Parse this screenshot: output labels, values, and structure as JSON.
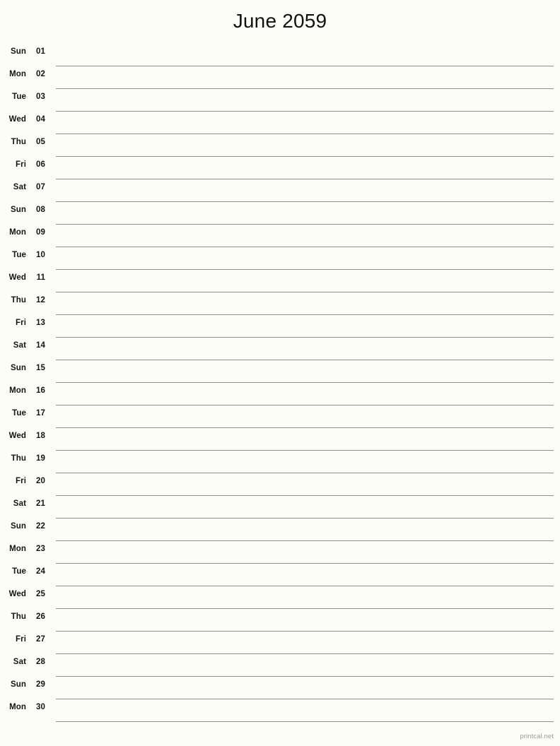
{
  "header": {
    "title": "June 2059"
  },
  "footer": {
    "credit": "printcal.net"
  },
  "colors": {
    "page_background": "#fdfdf8",
    "rule_line": "#8a8c86",
    "text": "#141414",
    "footer_text": "#9a9a96"
  },
  "calendar": {
    "month": "June",
    "year": "2059",
    "days": [
      {
        "weekday": "Sun",
        "daynum": "01"
      },
      {
        "weekday": "Mon",
        "daynum": "02"
      },
      {
        "weekday": "Tue",
        "daynum": "03"
      },
      {
        "weekday": "Wed",
        "daynum": "04"
      },
      {
        "weekday": "Thu",
        "daynum": "05"
      },
      {
        "weekday": "Fri",
        "daynum": "06"
      },
      {
        "weekday": "Sat",
        "daynum": "07"
      },
      {
        "weekday": "Sun",
        "daynum": "08"
      },
      {
        "weekday": "Mon",
        "daynum": "09"
      },
      {
        "weekday": "Tue",
        "daynum": "10"
      },
      {
        "weekday": "Wed",
        "daynum": "11"
      },
      {
        "weekday": "Thu",
        "daynum": "12"
      },
      {
        "weekday": "Fri",
        "daynum": "13"
      },
      {
        "weekday": "Sat",
        "daynum": "14"
      },
      {
        "weekday": "Sun",
        "daynum": "15"
      },
      {
        "weekday": "Mon",
        "daynum": "16"
      },
      {
        "weekday": "Tue",
        "daynum": "17"
      },
      {
        "weekday": "Wed",
        "daynum": "18"
      },
      {
        "weekday": "Thu",
        "daynum": "19"
      },
      {
        "weekday": "Fri",
        "daynum": "20"
      },
      {
        "weekday": "Sat",
        "daynum": "21"
      },
      {
        "weekday": "Sun",
        "daynum": "22"
      },
      {
        "weekday": "Mon",
        "daynum": "23"
      },
      {
        "weekday": "Tue",
        "daynum": "24"
      },
      {
        "weekday": "Wed",
        "daynum": "25"
      },
      {
        "weekday": "Thu",
        "daynum": "26"
      },
      {
        "weekday": "Fri",
        "daynum": "27"
      },
      {
        "weekday": "Sat",
        "daynum": "28"
      },
      {
        "weekday": "Sun",
        "daynum": "29"
      },
      {
        "weekday": "Mon",
        "daynum": "30"
      }
    ]
  }
}
